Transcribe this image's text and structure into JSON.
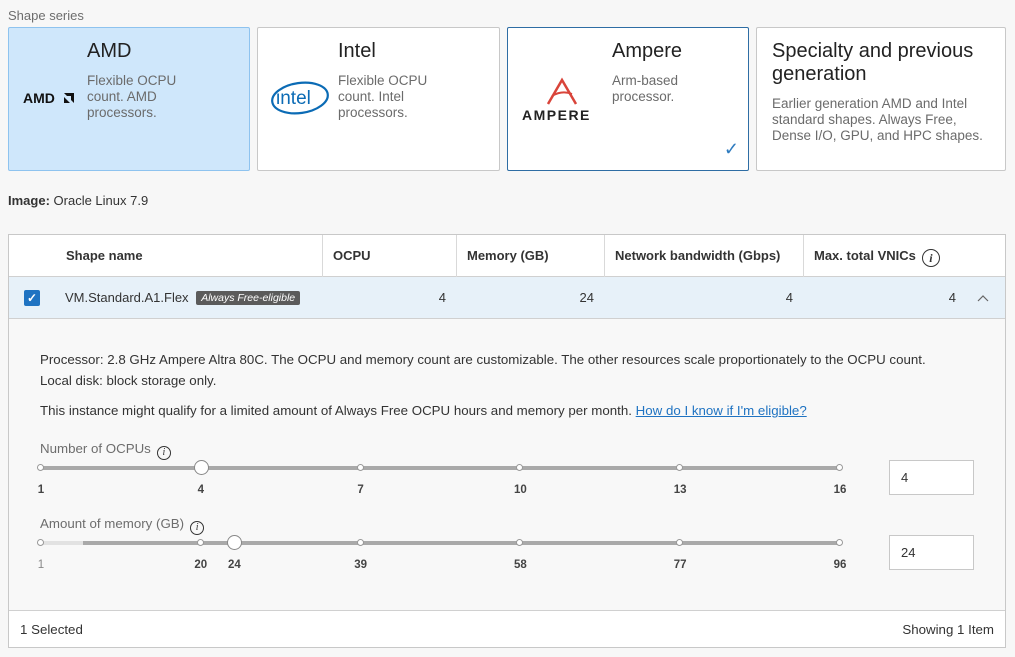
{
  "shape_series": {
    "label": "Shape series",
    "cards": [
      {
        "title": "AMD",
        "desc": "Flexible OCPU count. AMD processors.",
        "logo": "AMDZ"
      },
      {
        "title": "Intel",
        "desc": "Flexible OCPU count. Intel processors.",
        "logo": "intel"
      },
      {
        "title": "Ampere",
        "desc": "Arm-based processor.",
        "logo": "AMPERE"
      },
      {
        "title": "Specialty and previous generation",
        "desc": "Earlier generation AMD and Intel standard shapes. Always Free, Dense I/O, GPU, and HPC shapes."
      }
    ]
  },
  "image": {
    "label": "Image:",
    "value": "Oracle Linux 7.9"
  },
  "table": {
    "headers": [
      "Shape name",
      "OCPU",
      "Memory (GB)",
      "Network bandwidth (Gbps)",
      "Max. total VNICs"
    ],
    "row": {
      "name": "VM.Standard.A1.Flex",
      "badge": "Always Free-eligible",
      "ocpu": "4",
      "memory": "24",
      "bandwidth": "4",
      "vnics": "4"
    },
    "details": {
      "processor": "Processor: 2.8 GHz Ampere Altra 80C. The OCPU and memory count are customizable. The other resources scale proportionately to the OCPU count.",
      "disk": "Local disk: block storage only.",
      "free_text": "This instance might qualify for a limited amount of Always Free OCPU hours and memory per month.",
      "free_link": "How do I know if I'm eligible?"
    },
    "ocpu_slider": {
      "label": "Number of OCPUs",
      "ticks": [
        "1",
        "4",
        "7",
        "10",
        "13",
        "16"
      ],
      "min": 1,
      "max": 16,
      "value": 4,
      "input_value": "4"
    },
    "memory_slider": {
      "label": "Amount of memory (GB)",
      "ticks": [
        "1",
        "20",
        "24",
        "39",
        "58",
        "77",
        "96"
      ],
      "min": 1,
      "max": 96,
      "value": 24,
      "lower_bound": 6,
      "input_value": "24"
    },
    "footer": {
      "selected": "1 Selected",
      "showing": "Showing 1 Item"
    }
  },
  "colors": {
    "accent": "#1f73c2",
    "active_card": "#cfe7fb",
    "badge": "#5b5b5b"
  },
  "icons": {
    "check": "checkmark-icon",
    "chevron": "chevron-up-icon",
    "info": "info-icon"
  }
}
